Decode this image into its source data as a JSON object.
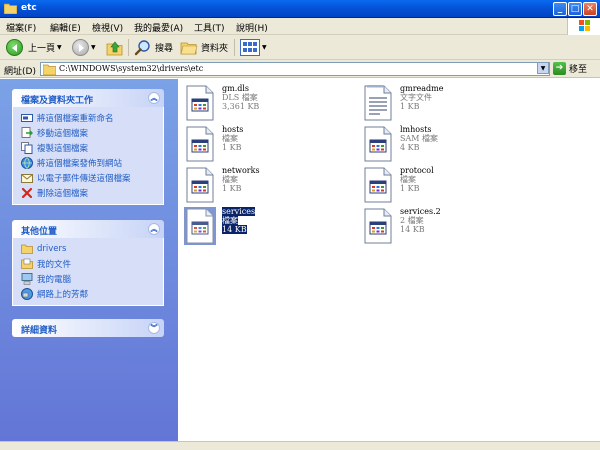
{
  "window": {
    "title": "etc"
  },
  "menu": [
    "檔案(F)",
    "編輯(E)",
    "檢視(V)",
    "我的最愛(A)",
    "工具(T)",
    "說明(H)"
  ],
  "toolbar": {
    "back_label": "上一頁",
    "search_label": "搜尋",
    "folders_label": "資料夾"
  },
  "address": {
    "label": "網址(D)",
    "path": "C:\\WINDOWS\\system32\\drivers\\etc",
    "go_label": "移至"
  },
  "tasks_panel": {
    "title": "檔案及資料夾工作",
    "items": [
      "將這個檔案重新命名",
      "移動這個檔案",
      "複製這個檔案",
      "將這個檔案發佈到網站",
      "以電子郵件傳送這個檔案",
      "刪除這個檔案"
    ]
  },
  "places_panel": {
    "title": "其他位置",
    "items": [
      "drivers",
      "我的文件",
      "我的電腦",
      "網路上的芳鄰"
    ]
  },
  "details_panel": {
    "title": "詳細資料"
  },
  "files": [
    {
      "name": "gm.dls",
      "type": "DLS 檔案",
      "size": "3,361 KB",
      "icon": "generic-file-icon",
      "selected": false
    },
    {
      "name": "gmreadme",
      "type": "文字文件",
      "size": "1 KB",
      "icon": "text-file-icon",
      "selected": false
    },
    {
      "name": "hosts",
      "type": "檔案",
      "size": "1 KB",
      "icon": "generic-file-icon",
      "selected": false
    },
    {
      "name": "lmhosts",
      "type": "SAM 檔案",
      "size": "4 KB",
      "icon": "generic-file-icon",
      "selected": false
    },
    {
      "name": "networks",
      "type": "檔案",
      "size": "1 KB",
      "icon": "generic-file-icon",
      "selected": false
    },
    {
      "name": "protocol",
      "type": "檔案",
      "size": "1 KB",
      "icon": "generic-file-icon",
      "selected": false
    },
    {
      "name": "services",
      "type": "檔案",
      "size": "14 KB",
      "icon": "generic-file-icon",
      "selected": true
    },
    {
      "name": "services.2",
      "type": "2 檔案",
      "size": "14 KB",
      "icon": "generic-file-icon",
      "selected": false
    }
  ],
  "colors": {
    "title_bar": "#0453d8",
    "task_text": "#215dc6",
    "selection": "#0a246a"
  }
}
